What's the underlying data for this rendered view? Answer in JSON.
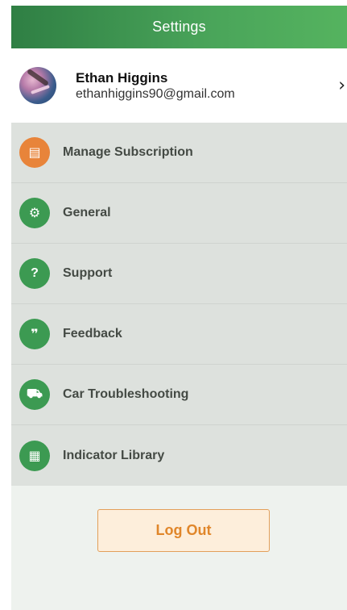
{
  "header": {
    "title": "Settings"
  },
  "profile": {
    "name": "Ethan Higgins",
    "email": "ethanhiggins90@gmail.com",
    "chevron": "›"
  },
  "menu": {
    "items": [
      {
        "label": "Manage Subscription",
        "icon": "subscription-card-icon",
        "color": "#e8843a",
        "glyph": "▤"
      },
      {
        "label": "General",
        "icon": "gear-list-icon",
        "color": "#3c9a52",
        "glyph": "⚙"
      },
      {
        "label": "Support",
        "icon": "support-chat-icon",
        "color": "#3c9a52",
        "glyph": "?"
      },
      {
        "label": "Feedback",
        "icon": "feedback-bubble-icon",
        "color": "#3c9a52",
        "glyph": "❞"
      },
      {
        "label": "Car Troubleshooting",
        "icon": "car-icon",
        "color": "#3c9a52",
        "glyph": "⛟"
      },
      {
        "label": "Indicator Library",
        "icon": "library-book-icon",
        "color": "#3c9a52",
        "glyph": "▦"
      }
    ]
  },
  "footer": {
    "logout_label": "Log Out"
  },
  "colors": {
    "header_green": "#3f9a52",
    "menu_bg": "#dde1dd",
    "logout_text": "#e0862a",
    "logout_border": "#e39f5a"
  }
}
